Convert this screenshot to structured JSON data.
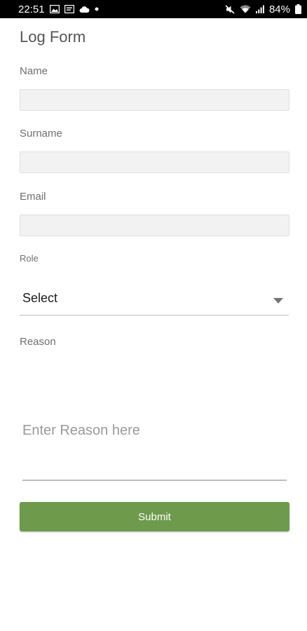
{
  "status_bar": {
    "time": "22:51",
    "battery": "84%",
    "left_icons": [
      "gallery-icon",
      "message-icon",
      "cloud-icon",
      "dot-icon"
    ],
    "right_icons": [
      "mute-icon",
      "wifi-icon",
      "signal-icon",
      "battery-icon"
    ]
  },
  "form": {
    "title": "Log Form",
    "fields": {
      "name": {
        "label": "Name",
        "value": "",
        "placeholder": ""
      },
      "surname": {
        "label": "Surname",
        "value": "",
        "placeholder": ""
      },
      "email": {
        "label": "Email",
        "value": "",
        "placeholder": ""
      }
    },
    "role": {
      "label": "Role",
      "selected": "Select"
    },
    "reason": {
      "label": "Reason",
      "placeholder": "Enter Reason here"
    },
    "submit_label": "Submit"
  },
  "colors": {
    "submit_button": "#6e9a4c",
    "input_background": "#f2f2f2",
    "status_bar": "#000000"
  }
}
